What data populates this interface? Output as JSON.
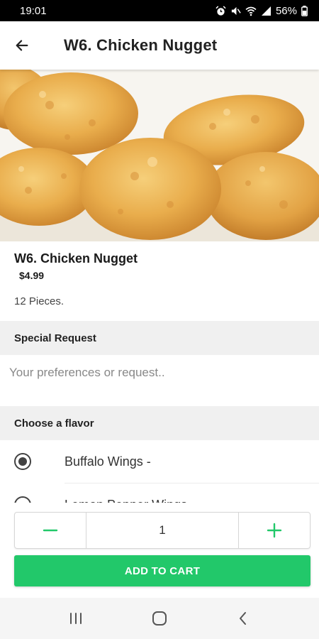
{
  "status_bar": {
    "time": "19:01",
    "battery": "56%",
    "icons": [
      "alarm-icon",
      "mute-icon",
      "wifi-icon",
      "signal-icon",
      "battery-icon"
    ]
  },
  "header": {
    "title": "W6. Chicken Nugget",
    "back_icon": "arrow-left-icon"
  },
  "item": {
    "name": "W6. Chicken Nugget",
    "price": "$4.99",
    "description": "12 Pieces."
  },
  "special_request": {
    "header": "Special Request",
    "placeholder": "Your preferences or request..",
    "value": ""
  },
  "flavor": {
    "header": "Choose a flavor",
    "options": [
      {
        "label": "Buffalo Wings  -",
        "selected": true
      },
      {
        "label": "Lemon Pepper Wings",
        "selected": false
      }
    ]
  },
  "order": {
    "quantity": "1",
    "decrement_icon": "minus-icon",
    "increment_icon": "plus-icon",
    "add_label": "ADD TO CART"
  },
  "nav_bar": {
    "icons": [
      "recent-apps-icon",
      "home-icon",
      "back-icon"
    ]
  },
  "colors": {
    "accent": "#22c86a",
    "status_bar": "#000000",
    "section_bg": "#f0f0f0"
  }
}
